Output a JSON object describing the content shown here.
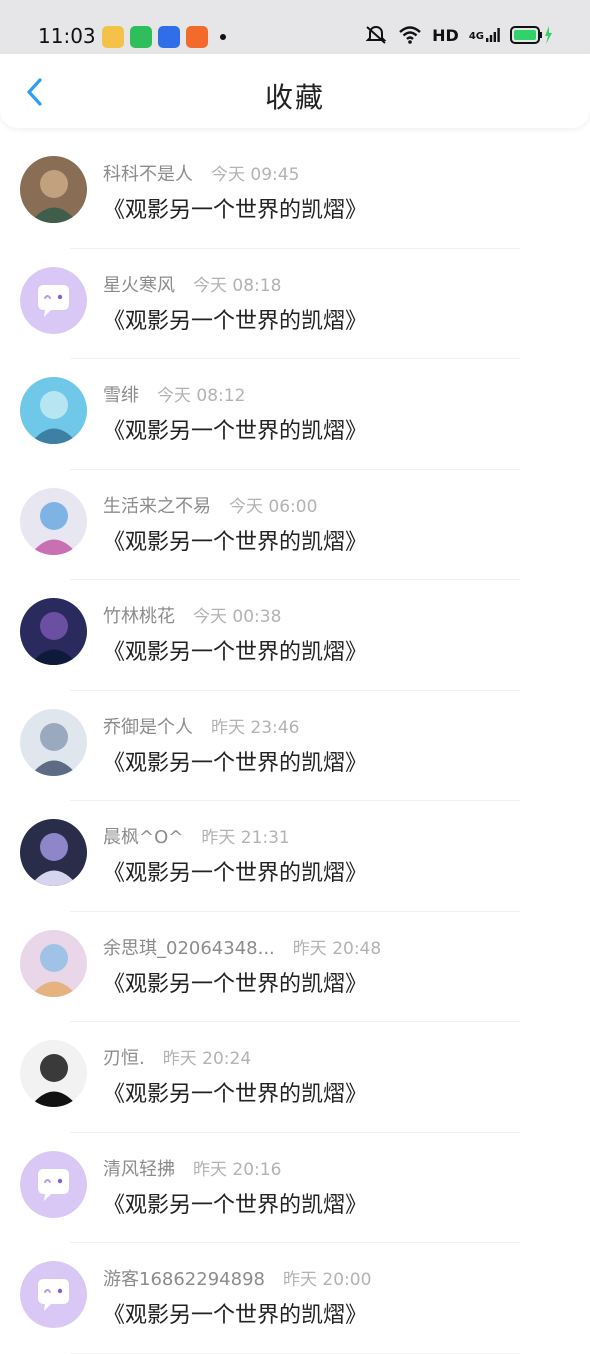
{
  "status_bar": {
    "time": "11:03",
    "apps": [
      {
        "name": "weibo-app-icon",
        "color": "#f5c249"
      },
      {
        "name": "video-app-icon",
        "color": "#2fbf5a"
      },
      {
        "name": "baidu-app-icon",
        "color": "#2f6ee8"
      },
      {
        "name": "shop-app-icon",
        "color": "#f36b2a"
      }
    ],
    "network": "HD",
    "signal_label": "4G",
    "battery_color": "#2fd36a"
  },
  "header": {
    "title": "收藏",
    "back_icon": "chevron-left-icon",
    "accent": "#2a9df4"
  },
  "items": [
    {
      "name": "科科不是人",
      "time": "今天 09:45",
      "work": "《观影另一个世界的凯熠》",
      "avatar": "photo"
    },
    {
      "name": "星火寒风",
      "time": "今天 08:18",
      "work": "《观影另一个世界的凯熠》",
      "avatar": "default"
    },
    {
      "name": "雪绯",
      "time": "今天 08:12",
      "work": "《观影另一个世界的凯熠》",
      "avatar": "photo"
    },
    {
      "name": "生活来之不易",
      "time": "今天 06:00",
      "work": "《观影另一个世界的凯熠》",
      "avatar": "photo"
    },
    {
      "name": "竹林桃花",
      "time": "今天 00:38",
      "work": "《观影另一个世界的凯熠》",
      "avatar": "photo"
    },
    {
      "name": "乔御是个人",
      "time": "昨天 23:46",
      "work": "《观影另一个世界的凯熠》",
      "avatar": "photo"
    },
    {
      "name": "晨枫^O^",
      "time": "昨天 21:31",
      "work": "《观影另一个世界的凯熠》",
      "avatar": "photo"
    },
    {
      "name": "余思琪_02064348...",
      "time": "昨天 20:48",
      "work": "《观影另一个世界的凯熠》",
      "avatar": "photo"
    },
    {
      "name": "刃恒.",
      "time": "昨天 20:24",
      "work": "《观影另一个世界的凯熠》",
      "avatar": "photo"
    },
    {
      "name": "清风轻拂",
      "time": "昨天 20:16",
      "work": "《观影另一个世界的凯熠》",
      "avatar": "default"
    },
    {
      "name": "游客16862294898",
      "time": "昨天 20:00",
      "work": "《观影另一个世界的凯熠》",
      "avatar": "default"
    }
  ]
}
